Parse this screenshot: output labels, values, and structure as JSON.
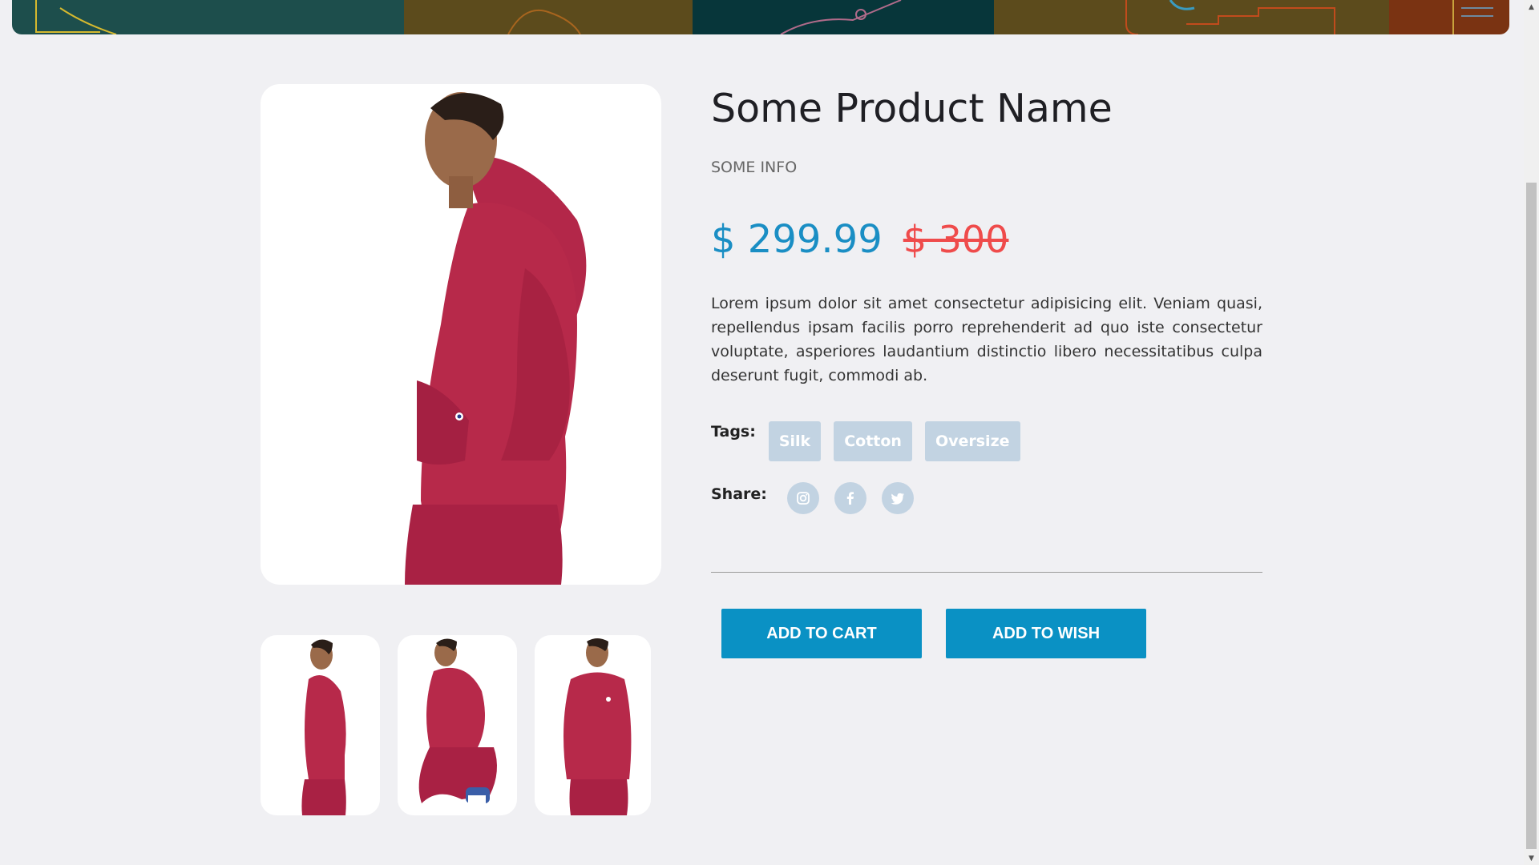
{
  "product": {
    "name": "Some Product Name",
    "info": "SOME INFO",
    "price": "$ 299.99",
    "old_price": "$ 300",
    "description": "Lorem ipsum dolor sit amet consectetur adipisicing elit. Veniam quasi, repellendus ipsam facilis porro reprehenderit ad quo iste consectetur voluptate, asperiores laudantium distinctio libero necessitatibus culpa deserunt fugit, commodi ab."
  },
  "tags": {
    "label": "Tags:",
    "items": [
      "Silk",
      "Cotton",
      "Oversize"
    ]
  },
  "share": {
    "label": "Share:",
    "icons": [
      "instagram-icon",
      "facebook-icon",
      "twitter-icon"
    ]
  },
  "buttons": {
    "add_to_cart": "ADD TO CART",
    "add_to_wish": "ADD TO WISH"
  },
  "colors": {
    "accent": "#0a91c4",
    "price": "#1a8ec4",
    "old_price": "#ef4b4b",
    "tag_bg": "#c2d3e2",
    "product": "#b7294a",
    "banner": [
      "#1d4e4c",
      "#5c4b1c",
      "#07363a",
      "#5c4b1c",
      "#7a3312"
    ]
  }
}
